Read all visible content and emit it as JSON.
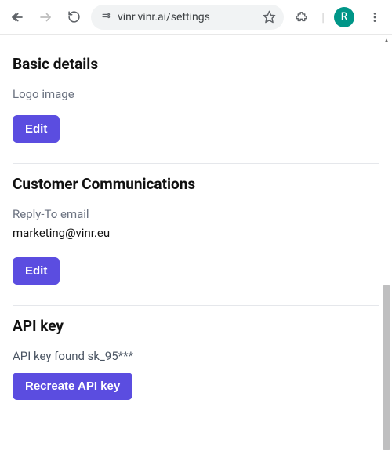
{
  "browser": {
    "url": "vinr.vinr.ai/settings",
    "avatar_letter": "R"
  },
  "sections": {
    "basic": {
      "title": "Basic details",
      "logo_label": "Logo image",
      "edit_label": "Edit"
    },
    "comms": {
      "title": "Customer Communications",
      "reply_label": "Reply-To email",
      "reply_value": "marketing@vinr.eu",
      "edit_label": "Edit"
    },
    "api": {
      "title": "API key",
      "status": "API key found sk_95***",
      "recreate_label": "Recreate API key"
    }
  }
}
